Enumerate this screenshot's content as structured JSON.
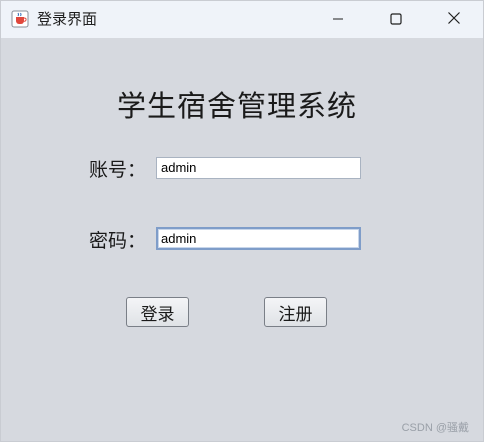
{
  "window": {
    "title": "登录界面",
    "app_icon": "java-coffee-icon",
    "controls": {
      "minimize_icon": "minimize-icon",
      "maximize_icon": "maximize-icon",
      "close_icon": "close-icon"
    }
  },
  "form": {
    "heading": "学生宿舍管理系统",
    "username_label": "账号：",
    "username_value": "admin",
    "password_label": "密码：",
    "password_value": "admin",
    "login_label": "登录",
    "register_label": "注册"
  },
  "watermark": "CSDN @骚戴",
  "colors": {
    "window_bg": "#d6d9df",
    "titlebar_bg": "#eff3f9",
    "focus_border": "#7f9dc9"
  }
}
